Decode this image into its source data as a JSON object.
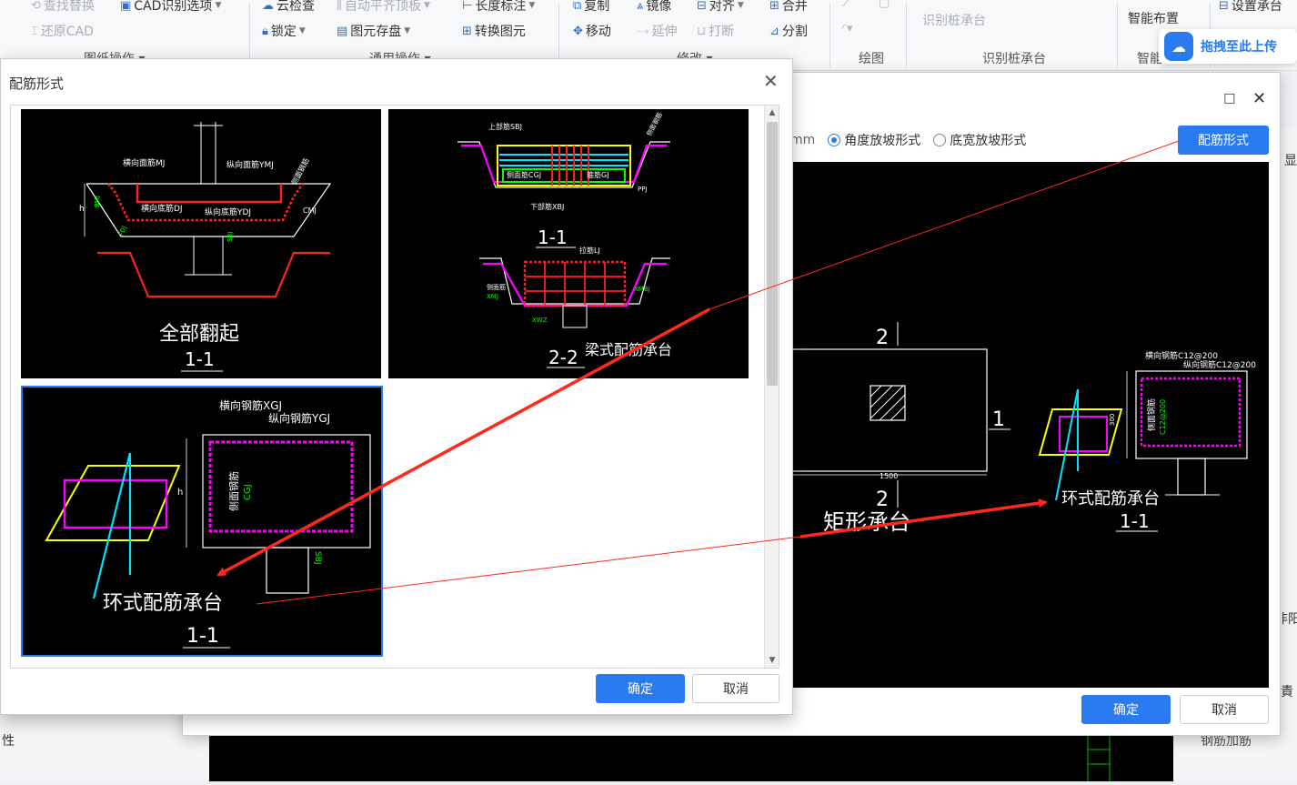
{
  "ribbon": {
    "items": {
      "find_replace": "查找替换",
      "cad_options": "CAD识别选项",
      "restore_cad": "还原CAD",
      "cloud_check": "云检查",
      "auto_align": "自动平齐顶板",
      "length_mark": "长度标注",
      "lock": "锁定",
      "store_element": "图元存盘",
      "convert_element": "转换图元",
      "copy": "复制",
      "mirror": "镜像",
      "align": "对齐",
      "merge": "合并",
      "move": "移动",
      "extend": "延伸",
      "break": "打断",
      "split": "分割",
      "recognize_pile_cap_btn": "识别桩承台",
      "smart_layout": "智能布置",
      "set_cap": "设置承台"
    },
    "groups": {
      "drawing_ops": "图纸操作",
      "common_ops": "通用操作",
      "modify": "修改",
      "draw": "绘图",
      "recognize_pile_cap": "识别桩承台",
      "smart": "智能"
    }
  },
  "upload_hint": "拖拽至此上传",
  "left_panel": {
    "attr": "性"
  },
  "right_panel": {
    "show": "显",
    "row2": "非阳",
    "row3": "責",
    "row4": "钢筋加筋"
  },
  "back_dialog": {
    "unit": "mm",
    "radio_angle": "角度放坡形式",
    "radio_bottom_width": "底宽放坡形式",
    "rebar_form_button": "配筋形式",
    "ok": "确定",
    "cancel": "取消",
    "preview": {
      "title": "矩形承台",
      "ring_label": "环式配筋承台",
      "section": "1-1",
      "mark_2_top": "2",
      "mark_2_bottom": "2",
      "mark_1": "1",
      "dim_1500": "1500",
      "dim_300": "300",
      "transverse": "横向钢筋C12@200",
      "longitudinal": "纵向钢筋C12@200",
      "side": "侧面钢筋",
      "side_code": "C12@200"
    }
  },
  "front_dialog": {
    "title": "配筋形式",
    "ok": "确定",
    "cancel": "取消",
    "tiles": [
      {
        "name": "全部翻起",
        "section": "1-1",
        "labels": {
          "transverse": "横向面筋MJ",
          "longitudinal": "纵向面筋YMJ",
          "bottom_t": "横向底筋DJ",
          "bottom_l": "纵向底筋YDJ",
          "side": "侧面钢筋",
          "cmj": "CMJ",
          "bmj": "BMJ",
          "fdj": "FDJ",
          "sbj": "SBJ",
          "h": "h"
        }
      },
      {
        "name": "梁式配筋承台",
        "section_1": "1-1",
        "section_2": "2-2",
        "labels": {
          "top": "上部筋SBJ",
          "side_ys": "侧面筋CGJ",
          "stirrup": "箍筋GJ",
          "bottom": "下部筋XBJ",
          "side_rebar": "侧面钢筋",
          "ppj": "PPJ",
          "lj": "拉筋LJ",
          "side_gj": "侧面筋",
          "xmj": "XMJ",
          "xmbj": "XMBJ",
          "xwz": "XWZ"
        }
      },
      {
        "name": "环式配筋承台",
        "section": "1-1",
        "labels": {
          "transverse": "横向钢筋XGJ",
          "longitudinal": "纵向钢筋YGJ",
          "side": "侧面钢筋",
          "cgj": "CGJ",
          "h": "h",
          "sbj": "SBJ"
        }
      }
    ]
  },
  "colors": {
    "accent": "#2b7bf0",
    "annotation_red": "#ff2a1a",
    "cad_magenta": "#ff00ff",
    "cad_yellow": "#ffff00",
    "cad_cyan": "#00e5ff",
    "cad_green": "#00ff00",
    "cad_red": "#ff2020"
  }
}
